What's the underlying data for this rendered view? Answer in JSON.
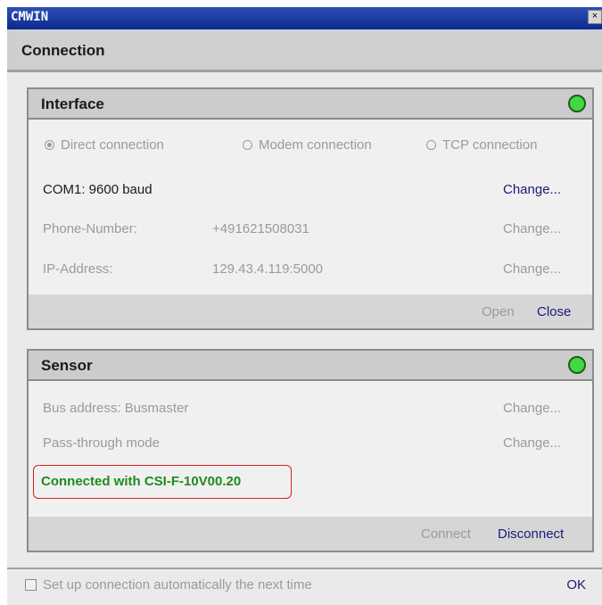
{
  "window": {
    "title": "CMWIN",
    "close_glyph": "×"
  },
  "header": {
    "title": "Connection"
  },
  "interface": {
    "title": "Interface",
    "status_color": "#44d744",
    "radios": [
      {
        "label": "Direct connection",
        "checked": true
      },
      {
        "label": "Modem connection",
        "checked": false
      },
      {
        "label": "TCP connection",
        "checked": false
      }
    ],
    "com": {
      "value": "COM1: 9600 baud",
      "change": "Change..."
    },
    "phone": {
      "label": "Phone-Number:",
      "value": "+491621508031",
      "change": "Change..."
    },
    "ip": {
      "label": "IP-Address:",
      "value": "129.43.4.119:5000",
      "change": "Change..."
    },
    "open": "Open",
    "close": "Close"
  },
  "sensor": {
    "title": "Sensor",
    "status_color": "#44d744",
    "bus": {
      "label": "Bus address: Busmaster",
      "change": "Change..."
    },
    "pass": {
      "label": "Pass-through mode",
      "change": "Change..."
    },
    "connected": "Connected with CSI-F-10V00.20",
    "connect": "Connect",
    "disconnect": "Disconnect"
  },
  "footer": {
    "auto_label": "Set up connection automatically the next time",
    "auto_checked": false,
    "ok": "OK"
  }
}
